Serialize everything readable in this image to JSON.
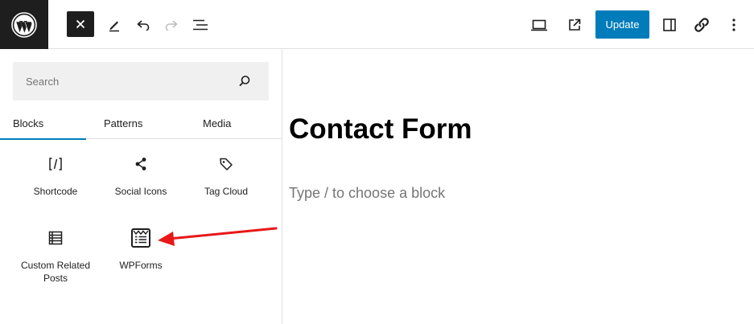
{
  "toolbar": {
    "close_icon": "close-icon",
    "tools_icon": "pencil-icon",
    "undo_icon": "undo-icon",
    "redo_icon": "redo-icon",
    "list_view_icon": "list-view-icon",
    "view_icon": "desktop-icon",
    "preview_icon": "external-link-icon",
    "update_label": "Update",
    "settings_icon": "sidebar-icon",
    "jetpack_icon": "link-icon",
    "options_icon": "more-vertical-icon"
  },
  "inserter": {
    "search_placeholder": "Search",
    "tabs": [
      {
        "label": "Blocks",
        "active": true
      },
      {
        "label": "Patterns",
        "active": false
      },
      {
        "label": "Media",
        "active": false
      }
    ],
    "blocks": [
      {
        "label": "Shortcode",
        "icon": "shortcode-icon"
      },
      {
        "label": "Social Icons",
        "icon": "share-icon"
      },
      {
        "label": "Tag Cloud",
        "icon": "tag-icon"
      },
      {
        "label": "Custom Related Posts",
        "icon": "list-icon"
      },
      {
        "label": "WPForms",
        "icon": "wpforms-icon"
      }
    ]
  },
  "editor": {
    "title": "Contact Form",
    "block_placeholder": "Type / to choose a block"
  },
  "colors": {
    "accent": "#007cba",
    "dark": "#1e1e1e",
    "annotation_arrow": "#e81818"
  }
}
